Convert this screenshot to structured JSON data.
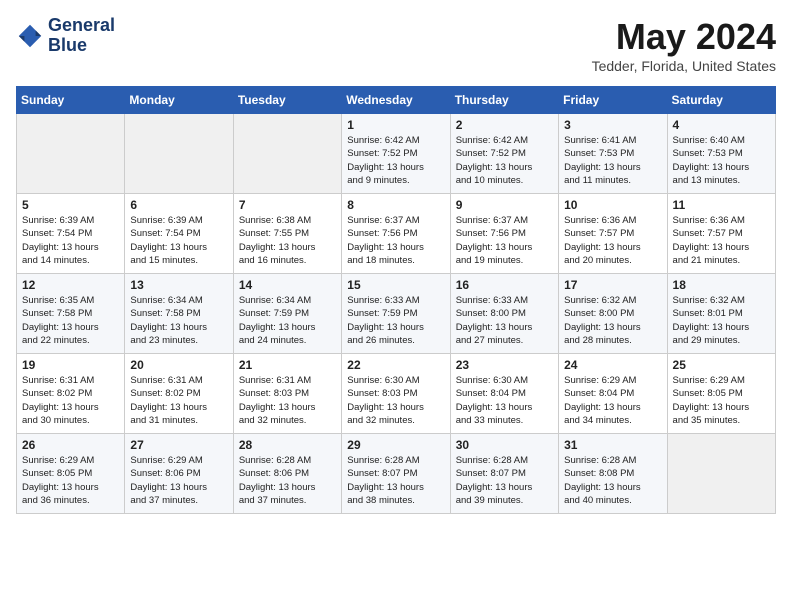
{
  "logo": {
    "line1": "General",
    "line2": "Blue"
  },
  "title": "May 2024",
  "subtitle": "Tedder, Florida, United States",
  "weekdays": [
    "Sunday",
    "Monday",
    "Tuesday",
    "Wednesday",
    "Thursday",
    "Friday",
    "Saturday"
  ],
  "weeks": [
    [
      {
        "day": "",
        "info": ""
      },
      {
        "day": "",
        "info": ""
      },
      {
        "day": "",
        "info": ""
      },
      {
        "day": "1",
        "info": "Sunrise: 6:42 AM\nSunset: 7:52 PM\nDaylight: 13 hours\nand 9 minutes."
      },
      {
        "day": "2",
        "info": "Sunrise: 6:42 AM\nSunset: 7:52 PM\nDaylight: 13 hours\nand 10 minutes."
      },
      {
        "day": "3",
        "info": "Sunrise: 6:41 AM\nSunset: 7:53 PM\nDaylight: 13 hours\nand 11 minutes."
      },
      {
        "day": "4",
        "info": "Sunrise: 6:40 AM\nSunset: 7:53 PM\nDaylight: 13 hours\nand 13 minutes."
      }
    ],
    [
      {
        "day": "5",
        "info": "Sunrise: 6:39 AM\nSunset: 7:54 PM\nDaylight: 13 hours\nand 14 minutes."
      },
      {
        "day": "6",
        "info": "Sunrise: 6:39 AM\nSunset: 7:54 PM\nDaylight: 13 hours\nand 15 minutes."
      },
      {
        "day": "7",
        "info": "Sunrise: 6:38 AM\nSunset: 7:55 PM\nDaylight: 13 hours\nand 16 minutes."
      },
      {
        "day": "8",
        "info": "Sunrise: 6:37 AM\nSunset: 7:56 PM\nDaylight: 13 hours\nand 18 minutes."
      },
      {
        "day": "9",
        "info": "Sunrise: 6:37 AM\nSunset: 7:56 PM\nDaylight: 13 hours\nand 19 minutes."
      },
      {
        "day": "10",
        "info": "Sunrise: 6:36 AM\nSunset: 7:57 PM\nDaylight: 13 hours\nand 20 minutes."
      },
      {
        "day": "11",
        "info": "Sunrise: 6:36 AM\nSunset: 7:57 PM\nDaylight: 13 hours\nand 21 minutes."
      }
    ],
    [
      {
        "day": "12",
        "info": "Sunrise: 6:35 AM\nSunset: 7:58 PM\nDaylight: 13 hours\nand 22 minutes."
      },
      {
        "day": "13",
        "info": "Sunrise: 6:34 AM\nSunset: 7:58 PM\nDaylight: 13 hours\nand 23 minutes."
      },
      {
        "day": "14",
        "info": "Sunrise: 6:34 AM\nSunset: 7:59 PM\nDaylight: 13 hours\nand 24 minutes."
      },
      {
        "day": "15",
        "info": "Sunrise: 6:33 AM\nSunset: 7:59 PM\nDaylight: 13 hours\nand 26 minutes."
      },
      {
        "day": "16",
        "info": "Sunrise: 6:33 AM\nSunset: 8:00 PM\nDaylight: 13 hours\nand 27 minutes."
      },
      {
        "day": "17",
        "info": "Sunrise: 6:32 AM\nSunset: 8:00 PM\nDaylight: 13 hours\nand 28 minutes."
      },
      {
        "day": "18",
        "info": "Sunrise: 6:32 AM\nSunset: 8:01 PM\nDaylight: 13 hours\nand 29 minutes."
      }
    ],
    [
      {
        "day": "19",
        "info": "Sunrise: 6:31 AM\nSunset: 8:02 PM\nDaylight: 13 hours\nand 30 minutes."
      },
      {
        "day": "20",
        "info": "Sunrise: 6:31 AM\nSunset: 8:02 PM\nDaylight: 13 hours\nand 31 minutes."
      },
      {
        "day": "21",
        "info": "Sunrise: 6:31 AM\nSunset: 8:03 PM\nDaylight: 13 hours\nand 32 minutes."
      },
      {
        "day": "22",
        "info": "Sunrise: 6:30 AM\nSunset: 8:03 PM\nDaylight: 13 hours\nand 32 minutes."
      },
      {
        "day": "23",
        "info": "Sunrise: 6:30 AM\nSunset: 8:04 PM\nDaylight: 13 hours\nand 33 minutes."
      },
      {
        "day": "24",
        "info": "Sunrise: 6:29 AM\nSunset: 8:04 PM\nDaylight: 13 hours\nand 34 minutes."
      },
      {
        "day": "25",
        "info": "Sunrise: 6:29 AM\nSunset: 8:05 PM\nDaylight: 13 hours\nand 35 minutes."
      }
    ],
    [
      {
        "day": "26",
        "info": "Sunrise: 6:29 AM\nSunset: 8:05 PM\nDaylight: 13 hours\nand 36 minutes."
      },
      {
        "day": "27",
        "info": "Sunrise: 6:29 AM\nSunset: 8:06 PM\nDaylight: 13 hours\nand 37 minutes."
      },
      {
        "day": "28",
        "info": "Sunrise: 6:28 AM\nSunset: 8:06 PM\nDaylight: 13 hours\nand 37 minutes."
      },
      {
        "day": "29",
        "info": "Sunrise: 6:28 AM\nSunset: 8:07 PM\nDaylight: 13 hours\nand 38 minutes."
      },
      {
        "day": "30",
        "info": "Sunrise: 6:28 AM\nSunset: 8:07 PM\nDaylight: 13 hours\nand 39 minutes."
      },
      {
        "day": "31",
        "info": "Sunrise: 6:28 AM\nSunset: 8:08 PM\nDaylight: 13 hours\nand 40 minutes."
      },
      {
        "day": "",
        "info": ""
      }
    ]
  ]
}
